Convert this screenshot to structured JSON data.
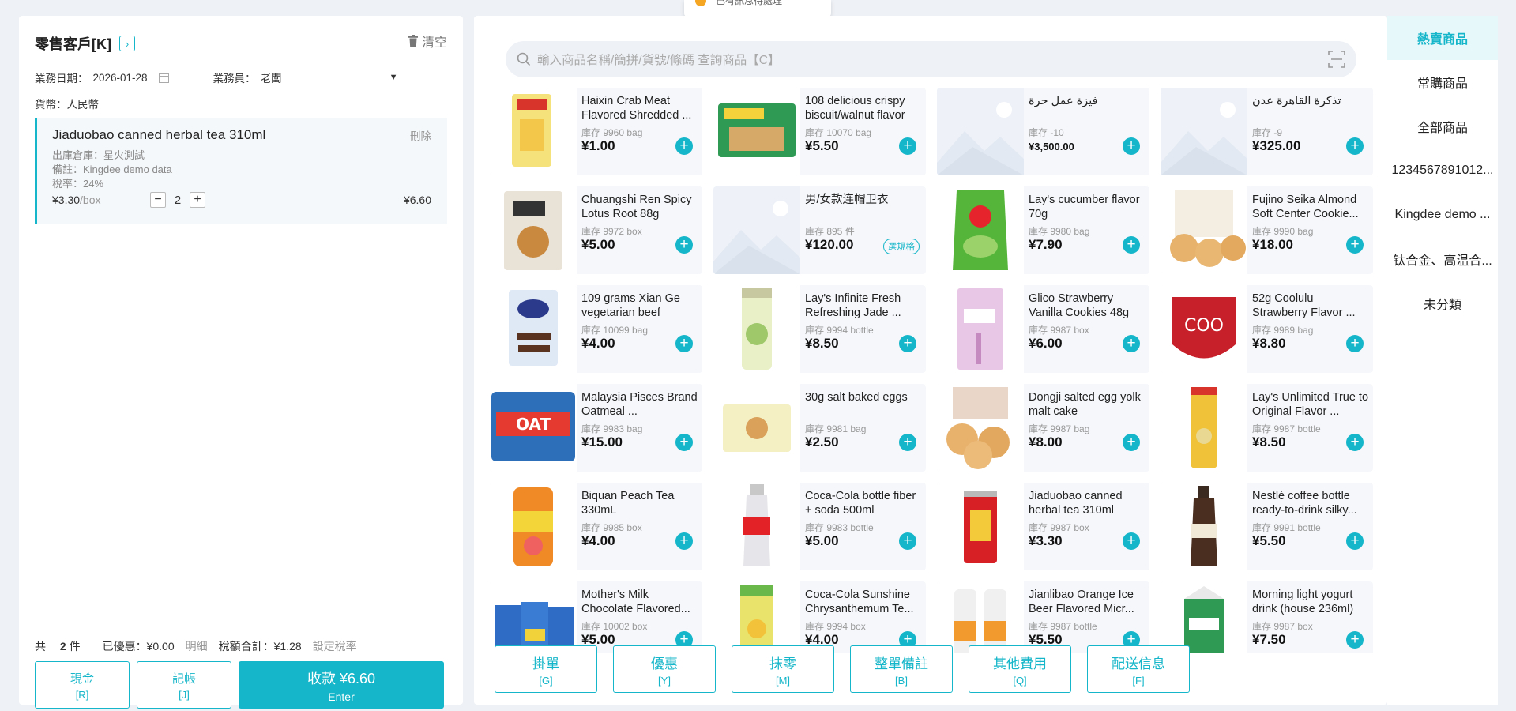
{
  "toast": {
    "text": "已有訊息待處理"
  },
  "customer": {
    "name": "零售客戶[K]",
    "clear_label": "清空"
  },
  "meta": {
    "date_label": "業務日期：",
    "date_value": "2026-01-28",
    "salesperson_label": "業務員：",
    "salesperson_value": "老闆",
    "currency_label": "貨幣：",
    "currency_value": "人民幣"
  },
  "cart": {
    "items": [
      {
        "name": "Jiaduobao canned herbal tea 310ml",
        "delete_label": "刪除",
        "warehouse": "出庫倉庫：星火測試",
        "remark": "備註：Kingdee demo data",
        "tax_rate": "稅率：24%",
        "unit_price": "¥3.30",
        "unit": "/box",
        "qty": "2",
        "total": "¥6.60"
      }
    ]
  },
  "summary": {
    "count_prefix": "共",
    "count": "2",
    "count_suffix": "件",
    "discount": "已優惠：¥0.00",
    "detail": "明細",
    "tax_total": "稅額合計：¥1.28",
    "set_tax": "設定稅率"
  },
  "payment": {
    "cash": {
      "label": "現金",
      "key": "[R]"
    },
    "credit": {
      "label": "記帳",
      "key": "[J]"
    },
    "checkout": {
      "label": "收款 ¥6.60",
      "key": "Enter"
    }
  },
  "search": {
    "placeholder": "輸入商品名稱/簡拼/貨號/條碼 查詢商品【C】"
  },
  "products": [
    {
      "name": "Haixin Crab Meat Flavored Shredded ...",
      "stock": "庫存 9960 bag",
      "price": "¥1.00",
      "thumb": "crab"
    },
    {
      "name": "108 delicious crispy biscuit/walnut flavor",
      "stock": "庫存 10070 bag",
      "price": "¥5.50",
      "thumb": "biscuit"
    },
    {
      "name": "فيزة عمل حرة",
      "stock": "庫存 -10",
      "price": "¥3,500.00",
      "thumb": "placeholder",
      "small": true
    },
    {
      "name": "تذكرة القاهرة عدن",
      "stock": "庫存 -9",
      "price": "¥325.00",
      "thumb": "placeholder"
    },
    {
      "name": "Chuangshi Ren Spicy Lotus Root 88g",
      "stock": "庫存 9972 box",
      "price": "¥5.00",
      "thumb": "lotus"
    },
    {
      "name": "男/女款连帽卫衣",
      "stock": "庫存 895 件",
      "price": "¥120.00",
      "thumb": "placeholder",
      "spec": "選規格"
    },
    {
      "name": "Lay's cucumber flavor 70g",
      "stock": "庫存 9980 bag",
      "price": "¥7.90",
      "thumb": "lays_green"
    },
    {
      "name": "Fujino Seika Almond Soft Center Cookie...",
      "stock": "庫存 9990 bag",
      "price": "¥18.00",
      "thumb": "cookie"
    },
    {
      "name": "109 grams Xian Ge vegetarian beef",
      "stock": "庫存 10099 bag",
      "price": "¥4.00",
      "thumb": "beef"
    },
    {
      "name": "Lay's Infinite Fresh Refreshing Jade ...",
      "stock": "庫存 9994 bottle",
      "price": "¥8.50",
      "thumb": "stax"
    },
    {
      "name": "Glico Strawberry Vanilla Cookies 48g",
      "stock": "庫存 9987 box",
      "price": "¥6.00",
      "thumb": "glico"
    },
    {
      "name": "52g Coolulu Strawberry Flavor ...",
      "stock": "庫存 9989 bag",
      "price": "¥8.80",
      "thumb": "coolulu"
    },
    {
      "name": "Malaysia Pisces Brand Oatmeal ...",
      "stock": "庫存 9983 bag",
      "price": "¥15.00",
      "thumb": "oat"
    },
    {
      "name": "30g salt baked eggs",
      "stock": "庫存 9981 bag",
      "price": "¥2.50",
      "thumb": "eggs"
    },
    {
      "name": "Dongji salted egg yolk malt cake",
      "stock": "庫存 9987 bag",
      "price": "¥8.00",
      "thumb": "cake"
    },
    {
      "name": "Lay's Unlimited True to Original Flavor ...",
      "stock": "庫存 9987 bottle",
      "price": "¥8.50",
      "thumb": "lays_can"
    },
    {
      "name": "Biquan Peach Tea 330mL",
      "stock": "庫存 9985 box",
      "price": "¥4.00",
      "thumb": "biquan"
    },
    {
      "name": "Coca-Cola bottle fiber + soda 500ml",
      "stock": "庫存 9983 bottle",
      "price": "¥5.00",
      "thumb": "coke"
    },
    {
      "name": "Jiaduobao canned herbal tea 310ml",
      "stock": "庫存 9987 box",
      "price": "¥3.30",
      "thumb": "jdb"
    },
    {
      "name": "Nestlé coffee bottle ready-to-drink silky...",
      "stock": "庫存 9991 bottle",
      "price": "¥5.50",
      "thumb": "nescafe"
    },
    {
      "name": "Mother's Milk Chocolate Flavored...",
      "stock": "庫存 10002 box",
      "price": "¥5.00",
      "thumb": "milk"
    },
    {
      "name": "Coca-Cola Sunshine Chrysanthemum Te...",
      "stock": "庫存 9994 box",
      "price": "¥4.00",
      "thumb": "tea"
    },
    {
      "name": "Jianlibao Orange Ice Beer Flavored Micr...",
      "stock": "庫存 9987 bottle",
      "price": "¥5.50",
      "thumb": "jianlibao"
    },
    {
      "name": "Morning light yogurt drink (house 236ml)",
      "stock": "庫存 9987 box",
      "price": "¥7.50",
      "thumb": "yogurt"
    }
  ],
  "actions": [
    {
      "label": "掛單",
      "key": "[G]",
      "name": "hold-order-button"
    },
    {
      "label": "優惠",
      "key": "[Y]",
      "name": "discount-button"
    },
    {
      "label": "抹零",
      "key": "[M]",
      "name": "round-off-button"
    },
    {
      "label": "整單備註",
      "key": "[B]",
      "name": "order-remark-button"
    },
    {
      "label": "其他費用",
      "key": "[Q]",
      "name": "other-fees-button"
    },
    {
      "label": "配送信息",
      "key": "[F]",
      "name": "delivery-info-button"
    }
  ],
  "categories": [
    {
      "label": "熱賣商品",
      "active": true
    },
    {
      "label": "常購商品"
    },
    {
      "label": "全部商品"
    },
    {
      "label": "1234567891012..."
    },
    {
      "label": "Kingdee demo ..."
    },
    {
      "label": "钛合金、高温合..."
    },
    {
      "label": "未分類"
    }
  ],
  "colors": {
    "accent": "#15b6c9",
    "active_bg": "#e6f8fa"
  }
}
